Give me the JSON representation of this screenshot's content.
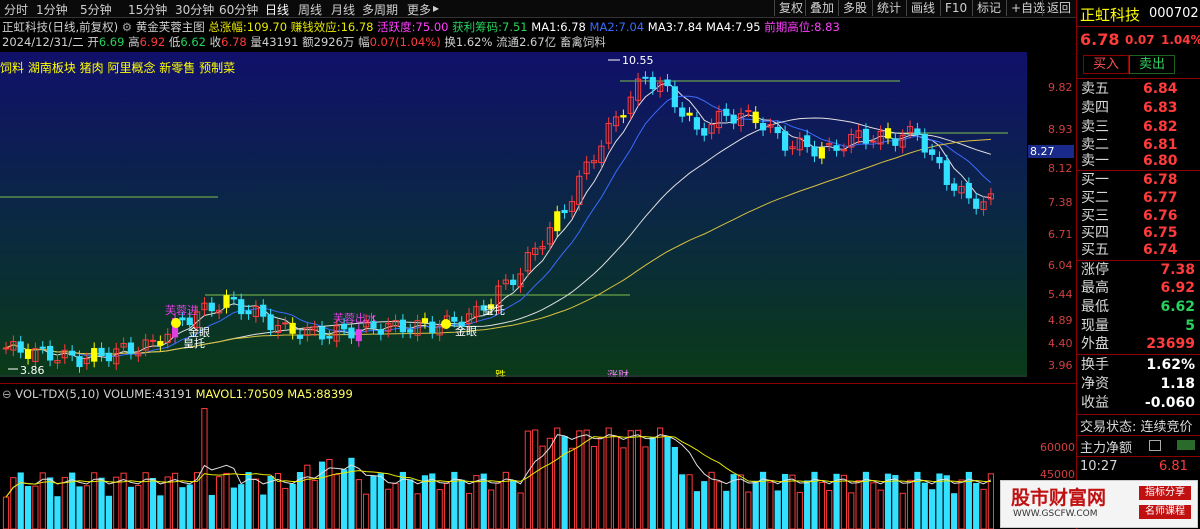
{
  "toolbar": {
    "periods": [
      "分时",
      "1分钟",
      "5分钟",
      "15分钟",
      "30分钟",
      "60分钟",
      "日线",
      "周线",
      "月线",
      "多周期",
      "更多"
    ],
    "active_period": "日线",
    "buttons": [
      "复权",
      "叠加",
      "多股",
      "统计",
      "画线",
      "F10",
      "标记",
      "+自选",
      "返回"
    ]
  },
  "info1": {
    "stock": "正虹科技(日线,前复权)",
    "indicator": "黄金芙蓉主图",
    "items": [
      {
        "label": "总涨幅:",
        "value": "109.70",
        "color": "#ffffff"
      },
      {
        "label": "赚钱效应:",
        "value": "16.78",
        "color": "#ffffff"
      },
      {
        "label": "活跃度:",
        "value": "75.00",
        "color": "#ff40ff"
      },
      {
        "label": "获利筹码:",
        "value": "7.51",
        "color": "#27d35b"
      },
      {
        "label": "MA1:",
        "value": "6.78",
        "color": "#ffffff"
      },
      {
        "label": "MA2:",
        "value": "7.04",
        "color": "#3a6bff"
      },
      {
        "label": "MA3:",
        "value": "7.84",
        "color": "#ffffff"
      },
      {
        "label": "MA4:",
        "value": "7.95",
        "color": "#ffffff"
      },
      {
        "label": "前期高位:",
        "value": "8.83",
        "color": "#ff40ff"
      }
    ]
  },
  "info2": {
    "date": "2024/12/31/二",
    "open_label": "开",
    "open": "6.69",
    "high_label": "高",
    "high": "6.92",
    "low_label": "低",
    "low": "6.62",
    "close_label": "收",
    "close": "6.78",
    "vol_label": "量",
    "vol": "43191",
    "amt_label": "额",
    "amt": "2926万",
    "chg_label": "幅",
    "chg": "0.07(1.04%)",
    "turn_label": "换",
    "turn": "1.62%",
    "float_label": "流通",
    "float": "2.67亿",
    "concept": "畜禽饲料"
  },
  "concepts": "饲料 湖南板块 猪肉 阿里概念 新零售 预制菜",
  "main_axis": [
    "9.82",
    "8.93",
    "8.12",
    "7.38",
    "6.71",
    "6.04",
    "5.44",
    "4.89",
    "4.40",
    "3.96"
  ],
  "current_price_marker": "8.27",
  "annotations": {
    "peak": "10.55",
    "low": "3.86",
    "furong_jin": "芙蓉进",
    "furong_chu": "芙蓉出水",
    "huanghou1": "皇托",
    "huanghou2": "皇托",
    "jinyan1": "金眼",
    "jinyan2": "金眼",
    "die": "跌",
    "zhang": "涨财"
  },
  "vol_info": {
    "name": "VOL-TDX(5,10)",
    "volume_label": "VOLUME:",
    "volume": "43191",
    "mavol1_label": "MAVOL1:",
    "mavol1": "70509",
    "ma5_label": "MA5:",
    "ma5": "88399"
  },
  "vol_axis": [
    "60000",
    "45000",
    "30000"
  ],
  "panel": {
    "name": "正虹科技",
    "code": "000702",
    "price": "6.78",
    "change": "0.07",
    "change_pct": "1.04%",
    "buy_btn": "买入",
    "sell_btn": "卖出",
    "asks": [
      {
        "label": "卖五",
        "price": "6.84"
      },
      {
        "label": "卖四",
        "price": "6.83"
      },
      {
        "label": "卖三",
        "price": "6.82"
      },
      {
        "label": "卖二",
        "price": "6.81"
      },
      {
        "label": "卖一",
        "price": "6.80"
      }
    ],
    "bids": [
      {
        "label": "买一",
        "price": "6.78"
      },
      {
        "label": "买二",
        "price": "6.77"
      },
      {
        "label": "买三",
        "price": "6.76"
      },
      {
        "label": "买四",
        "price": "6.75"
      },
      {
        "label": "买五",
        "price": "6.74"
      }
    ],
    "stats": [
      {
        "label": "涨停",
        "value": "7.38"
      },
      {
        "label": "最高",
        "value": "6.92"
      },
      {
        "label": "最低",
        "value": "6.62"
      },
      {
        "label": "现量",
        "value": "5"
      },
      {
        "label": "外盘",
        "value": "23699"
      }
    ],
    "stats2": [
      {
        "label": "换手",
        "value": "1.62%"
      },
      {
        "label": "净资",
        "value": "1.18"
      },
      {
        "label": "收益",
        "value": "-0.060"
      }
    ],
    "trade_status": "交易状态: 连续竞价",
    "main_net": "主力净额",
    "time": "10:27",
    "time_price": "6.81"
  },
  "watermark": {
    "title": "股市财富网",
    "url": "WWW.GSCFW.COM",
    "tag1": "指标分享",
    "tag2": "名师课程"
  },
  "colors": {
    "up": "#ff3b3b",
    "down": "#33e0ff",
    "ma_white": "#e0e0e0",
    "ma_yellow": "#d8c040",
    "ma_blue": "#3a6bff",
    "line_green": "#7fc04a",
    "furong_yellow": "#ffff00",
    "furong_magenta": "#e040e0"
  }
}
